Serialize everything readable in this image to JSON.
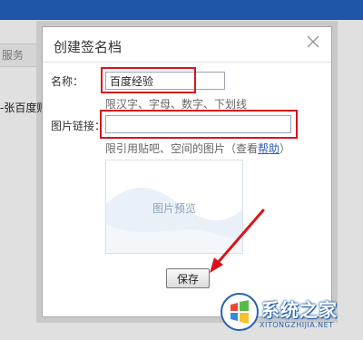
{
  "background": {
    "tab_label": "服务",
    "body_text": "-张百度贴"
  },
  "dialog": {
    "title": "创建签名档",
    "close_icon": "close-icon",
    "name": {
      "label": "名称：",
      "value": "百度经验",
      "hint": "限汉字、字母、数字、下划线"
    },
    "image_link": {
      "label": "图片链接：",
      "value": "",
      "hint_prefix": "限引用贴吧、空间的图片（查看",
      "help_link": "帮助",
      "hint_suffix": "）"
    },
    "preview": {
      "label": "图片预览"
    },
    "save_label": "保存"
  },
  "annotations": {
    "highlight_color": "#d8141b",
    "arrow_icon": "red-arrow-icon"
  },
  "watermark": {
    "main_text": "系统之家",
    "sub_text": "XITONGZHIJIA.NET",
    "logo_icon": "windows-logo-icon"
  },
  "colors": {
    "topbar": "#1f56a8",
    "link": "#2b5fb5",
    "preview_text": "#8da3bb"
  }
}
